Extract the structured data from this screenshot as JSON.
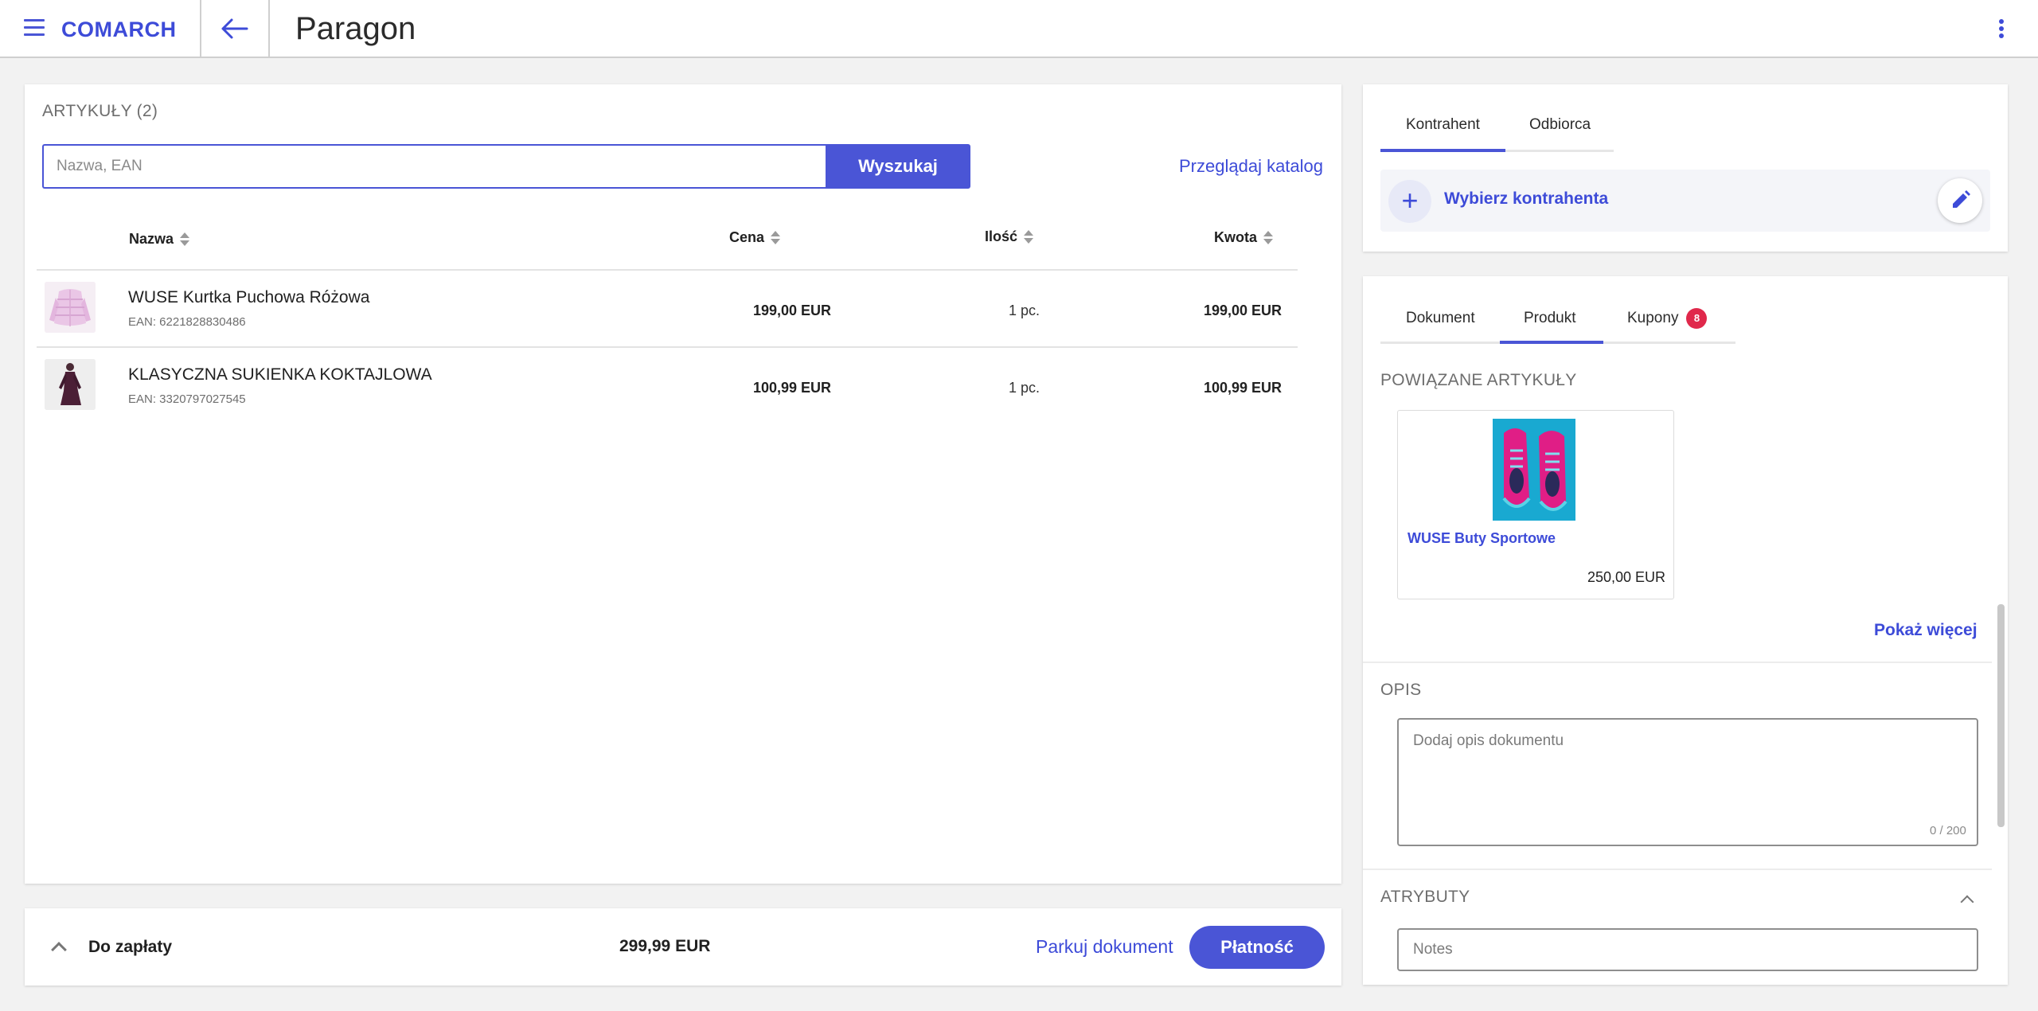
{
  "header": {
    "logo": "COMARCH",
    "title": "Paragon"
  },
  "articles": {
    "section_label": "ARTYKUŁY (2)",
    "search_placeholder": "Nazwa, EAN",
    "search_button": "Wyszukaj",
    "catalog_link": "Przeglądaj katalog",
    "columns": {
      "name": "Nazwa",
      "price": "Cena",
      "quantity": "Ilość",
      "amount": "Kwota"
    },
    "rows": [
      {
        "name": "WUSE Kurtka Puchowa Różowa",
        "ean": "EAN: 6221828830486",
        "price": "199,00 EUR",
        "quantity": "1 pc.",
        "amount": "199,00 EUR"
      },
      {
        "name": "KLASYCZNA SUKIENKA KOKTAJLOWA",
        "ean": "EAN: 3320797027545",
        "price": "100,99 EUR",
        "quantity": "1 pc.",
        "amount": "100,99 EUR"
      }
    ]
  },
  "summary": {
    "label": "Do zapłaty",
    "total": "299,99 EUR",
    "park_button": "Parkuj dokument",
    "pay_button": "Płatność"
  },
  "client": {
    "tabs": [
      "Kontrahent",
      "Odbiorca"
    ],
    "active_tab": "Kontrahent",
    "select_label": "Wybierz kontrahenta"
  },
  "details": {
    "tabs": [
      "Dokument",
      "Produkt",
      "Kupony"
    ],
    "active_tab": "Produkt",
    "coupons_badge": "8",
    "related_label": "POWIĄZANE ARTYKUŁY",
    "related_items": [
      {
        "name": "WUSE Buty Sportowe",
        "price": "250,00 EUR"
      }
    ],
    "show_more": "Pokaż więcej",
    "description_label": "OPIS",
    "description_placeholder": "Dodaj opis dokumentu",
    "description_counter": "0 / 200",
    "attributes_label": "ATRYBUTY",
    "notes_placeholder": "Notes"
  },
  "colors": {
    "accent": "#4a55d6",
    "badge": "#e0284b",
    "background": "#f2f2f2"
  }
}
